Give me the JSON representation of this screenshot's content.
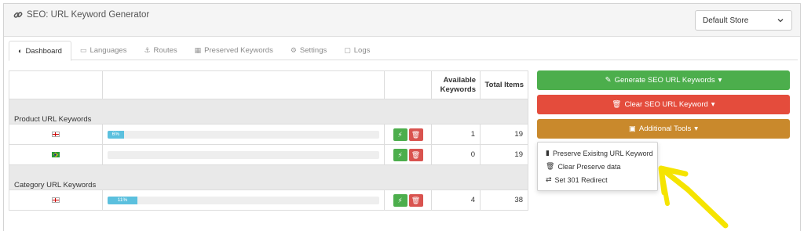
{
  "header": {
    "title": "SEO: URL Keyword Generator",
    "store_select": {
      "selected": "Default Store"
    }
  },
  "tabs": [
    {
      "label": "Dashboard",
      "icon": "dashboard-icon",
      "active": true
    },
    {
      "label": "Languages",
      "icon": "languages-icon",
      "active": false
    },
    {
      "label": "Routes",
      "icon": "anchor-icon",
      "active": false
    },
    {
      "label": "Preserved Keywords",
      "icon": "table-icon",
      "active": false
    },
    {
      "label": "Settings",
      "icon": "cogs-icon",
      "active": false
    },
    {
      "label": "Logs",
      "icon": "note-icon",
      "active": false
    }
  ],
  "table": {
    "headers": {
      "available": "Available Keywords",
      "total": "Total Items"
    },
    "groups": [
      {
        "title": "Product URL Keywords",
        "rows": [
          {
            "flag": "uk",
            "progress_percent": 6,
            "progress_label": "6%",
            "available": "1",
            "total": "19"
          },
          {
            "flag": "br",
            "progress_percent": 0,
            "progress_label": "",
            "available": "0",
            "total": "19"
          }
        ]
      },
      {
        "title": "Category URL Keywords",
        "rows": [
          {
            "flag": "uk",
            "progress_percent": 11,
            "progress_label": "11%",
            "available": "4",
            "total": "38"
          }
        ]
      }
    ]
  },
  "actions": {
    "generate_label": "Generate SEO URL Keywords",
    "clear_label": "Clear SEO URL Keyword",
    "tools_label": "Additional Tools",
    "tools_menu": [
      {
        "label": "Preserve Exisitng URL Keyword",
        "icon": "bookmark-icon"
      },
      {
        "label": "Clear Preserve data",
        "icon": "trash-icon"
      },
      {
        "label": "Set 301 Redirect",
        "icon": "exchange-icon"
      }
    ]
  },
  "colors": {
    "green": "#4cae4c",
    "red": "#e44c3c",
    "orange": "#c9892c",
    "progress": "#5bc0de",
    "annotation_arrow": "#f5e400"
  }
}
